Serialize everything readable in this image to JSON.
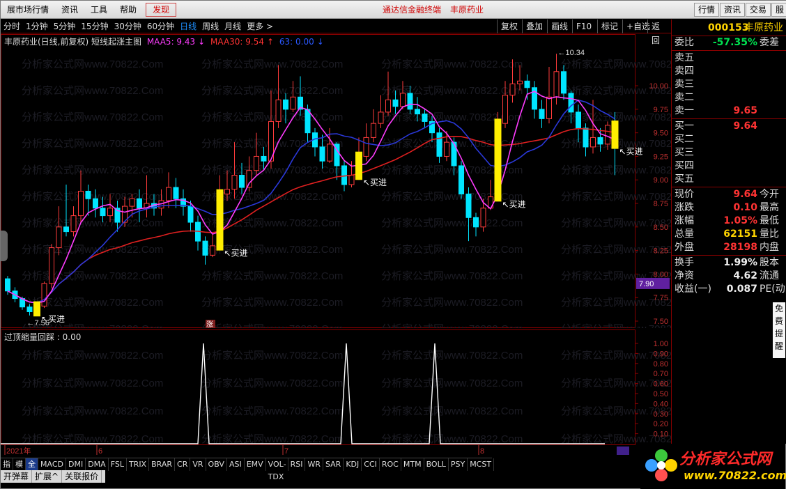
{
  "menubar": {
    "items": [
      "展市场行情",
      "资讯",
      "工具",
      "帮助",
      "发现"
    ],
    "center_title": "通达信金融终端",
    "center_stock": "丰原药业",
    "right_buttons": [
      "行情",
      "资讯",
      "交易",
      "服"
    ]
  },
  "periodbar": {
    "items": [
      "分时",
      "1分钟",
      "5分钟",
      "15分钟",
      "30分钟",
      "60分钟",
      "日线",
      "周线",
      "月线",
      "更多 >"
    ],
    "selected": "日线",
    "tools": [
      "复权",
      "叠加",
      "画线",
      "F10",
      "标记",
      "+自选",
      "返回"
    ]
  },
  "legend": {
    "title": "丰原药业(日线,前复权) 短线起涨主图",
    "maa5": "MAA5: 9.43",
    "maa30": "MAA30: 9.54",
    "extra": "63: 0.00"
  },
  "subchart": {
    "title": "过顶缩量回踩 : 0.00"
  },
  "chart_data": {
    "type": "candlestick",
    "ylim": [
      7.5,
      10.4
    ],
    "y_ticks": [
      "10.00",
      "9.75",
      "9.50",
      "9.25",
      "9.00",
      "8.75",
      "8.50",
      "8.25",
      "8.00",
      "7.75",
      "7.50"
    ],
    "y_tick_values": [
      10.0,
      9.75,
      9.5,
      9.25,
      9.0,
      8.75,
      8.5,
      8.25,
      8.0,
      7.75,
      7.5
    ],
    "current_price_tag": "7.90",
    "high_annotation": "10.34",
    "low_annotation": "7.56",
    "signal_label": "买进",
    "up_label": "涨",
    "x_labels": [
      "2021年",
      "6",
      "7",
      "8"
    ],
    "candles": [
      [
        7.95,
        7.82,
        7.98,
        7.78
      ],
      [
        7.82,
        7.74,
        7.86,
        7.7
      ],
      [
        7.74,
        7.65,
        7.76,
        7.62
      ],
      [
        7.65,
        7.6,
        7.68,
        7.56
      ],
      [
        7.6,
        7.66,
        7.7,
        7.58
      ],
      [
        7.66,
        7.9,
        7.92,
        7.64
      ],
      [
        7.9,
        8.28,
        8.32,
        7.85
      ],
      [
        8.28,
        8.5,
        8.72,
        8.2
      ],
      [
        8.5,
        8.45,
        8.95,
        8.4
      ],
      [
        8.45,
        8.62,
        8.72,
        8.4
      ],
      [
        8.62,
        8.88,
        9.1,
        8.55
      ],
      [
        8.88,
        8.8,
        8.95,
        8.62
      ],
      [
        8.8,
        8.7,
        8.9,
        8.6
      ],
      [
        8.7,
        8.62,
        8.82,
        8.55
      ],
      [
        8.62,
        8.7,
        8.85,
        8.55
      ],
      [
        8.7,
        8.55,
        8.78,
        8.45
      ],
      [
        8.55,
        8.72,
        8.82,
        8.5
      ],
      [
        8.72,
        8.8,
        8.85,
        8.6
      ],
      [
        8.8,
        8.7,
        8.9,
        8.55
      ],
      [
        8.7,
        8.75,
        9.05,
        8.6
      ],
      [
        8.75,
        8.7,
        8.85,
        8.62
      ],
      [
        8.7,
        8.78,
        8.9,
        8.62
      ],
      [
        8.78,
        8.92,
        9.08,
        8.7
      ],
      [
        8.92,
        8.8,
        9.02,
        8.7
      ],
      [
        8.8,
        8.72,
        8.9,
        8.62
      ],
      [
        8.72,
        8.55,
        8.78,
        8.45
      ],
      [
        8.55,
        8.35,
        8.62,
        8.25
      ],
      [
        8.35,
        8.2,
        8.4,
        8.1
      ],
      [
        8.2,
        8.3,
        8.42,
        8.18
      ],
      [
        8.3,
        8.85,
        9.05,
        8.3
      ],
      [
        8.85,
        8.9,
        9.1,
        8.78
      ],
      [
        8.9,
        9.05,
        9.4,
        8.8
      ],
      [
        9.05,
        8.92,
        9.18,
        8.85
      ],
      [
        8.92,
        9.1,
        9.25,
        8.88
      ],
      [
        9.1,
        9.25,
        9.5,
        9.05
      ],
      [
        9.25,
        9.2,
        9.35,
        9.1
      ],
      [
        9.2,
        9.62,
        9.95,
        9.12
      ],
      [
        9.62,
        9.85,
        10.22,
        9.55
      ],
      [
        9.85,
        9.75,
        9.92,
        9.6
      ],
      [
        9.75,
        9.88,
        10.05,
        9.72
      ],
      [
        9.88,
        9.75,
        10.1,
        9.68
      ],
      [
        9.75,
        9.5,
        9.8,
        9.4
      ],
      [
        9.5,
        9.35,
        9.55,
        9.25
      ],
      [
        9.35,
        9.2,
        9.48,
        9.12
      ],
      [
        9.2,
        9.38,
        9.55,
        9.18
      ],
      [
        9.38,
        9.15,
        9.4,
        9.0
      ],
      [
        9.15,
        8.95,
        9.2,
        8.88
      ],
      [
        8.95,
        9.05,
        9.2,
        8.92
      ],
      [
        9.05,
        9.25,
        9.45,
        9.0
      ],
      [
        9.25,
        9.45,
        9.6,
        9.2
      ],
      [
        9.45,
        9.6,
        9.75,
        9.4
      ],
      [
        9.6,
        9.72,
        9.9,
        9.55
      ],
      [
        9.72,
        9.85,
        10.15,
        9.68
      ],
      [
        9.85,
        9.78,
        9.95,
        9.7
      ],
      [
        9.78,
        9.92,
        10.05,
        9.75
      ],
      [
        9.92,
        9.75,
        10.0,
        9.7
      ],
      [
        9.75,
        9.7,
        9.88,
        9.62
      ],
      [
        9.7,
        9.62,
        9.75,
        9.55
      ],
      [
        9.62,
        9.5,
        9.68,
        9.4
      ],
      [
        9.5,
        9.25,
        9.55,
        9.18
      ],
      [
        9.25,
        9.4,
        9.52,
        9.2
      ],
      [
        9.4,
        9.15,
        9.45,
        9.05
      ],
      [
        9.15,
        8.85,
        9.2,
        8.8
      ],
      [
        8.85,
        8.6,
        8.92,
        8.35
      ],
      [
        8.6,
        8.5,
        8.65,
        8.4
      ],
      [
        8.5,
        8.7,
        8.8,
        8.45
      ],
      [
        8.7,
        8.82,
        9.0,
        8.68
      ],
      [
        8.82,
        9.6,
        9.72,
        8.8
      ],
      [
        9.6,
        9.9,
        10.05,
        9.55
      ],
      [
        9.9,
        10.02,
        10.28,
        9.82
      ],
      [
        10.02,
        10.05,
        10.22,
        9.95
      ],
      [
        10.05,
        9.98,
        10.12,
        9.85
      ],
      [
        9.98,
        9.75,
        10.05,
        9.65
      ],
      [
        9.75,
        9.65,
        9.85,
        9.55
      ],
      [
        9.65,
        9.88,
        10.2,
        9.6
      ],
      [
        9.88,
        10.15,
        10.34,
        9.8
      ],
      [
        10.15,
        9.92,
        10.22,
        9.85
      ],
      [
        9.92,
        9.72,
        9.95,
        9.6
      ],
      [
        9.72,
        9.55,
        9.8,
        9.4
      ],
      [
        9.55,
        9.35,
        9.6,
        9.25
      ],
      [
        9.35,
        9.45,
        9.85,
        9.28
      ],
      [
        9.45,
        9.38,
        9.55,
        9.3
      ],
      [
        9.38,
        9.58,
        9.62,
        9.32
      ],
      [
        9.58,
        9.38,
        9.72,
        9.05
      ]
    ],
    "buy_signals": [
      4,
      29,
      48,
      67,
      83
    ],
    "indicator_x": [
      0,
      283,
      291,
      299,
      488,
      496,
      504,
      615,
      623,
      631,
      867
    ],
    "indicator_ylim": [
      0,
      1.0
    ],
    "indicator_ticks": [
      "1.00",
      "0.90",
      "0.80",
      "0.70",
      "0.60",
      "0.50",
      "0.40",
      "0.30",
      "0.20",
      "0.10"
    ]
  },
  "rpanel": {
    "code": "000153",
    "name": "丰原药业",
    "weibi": {
      "label": "委比",
      "value": "-57.35%",
      "label2": "委差"
    },
    "sells": [
      {
        "label": "卖五",
        "price": ""
      },
      {
        "label": "卖四",
        "price": ""
      },
      {
        "label": "卖三",
        "price": ""
      },
      {
        "label": "卖二",
        "price": ""
      },
      {
        "label": "卖一",
        "price": "9.65"
      }
    ],
    "buys": [
      {
        "label": "买一",
        "price": "9.64"
      },
      {
        "label": "买二",
        "price": ""
      },
      {
        "label": "买三",
        "price": ""
      },
      {
        "label": "买四",
        "price": ""
      },
      {
        "label": "买五",
        "price": ""
      }
    ],
    "stats": [
      {
        "label": "现价",
        "value": "9.64",
        "label2": "今开",
        "color": "#ff3333"
      },
      {
        "label": "涨跌",
        "value": "0.10",
        "label2": "最高",
        "color": "#ff3333"
      },
      {
        "label": "涨幅",
        "value": "1.05%",
        "label2": "最低",
        "color": "#ff3333"
      },
      {
        "label": "总量",
        "value": "62151",
        "label2": "量比",
        "color": "#ffd400"
      },
      {
        "label": "外盘",
        "value": "28198",
        "label2": "内盘",
        "color": "#ff3333"
      }
    ],
    "stats2": [
      {
        "label": "换手",
        "value": "1.99%",
        "label2": "股本",
        "color": "#eeeeee"
      },
      {
        "label": "净资",
        "value": "4.62",
        "label2": "流通",
        "color": "#eeeeee"
      },
      {
        "label": "收益(一)",
        "value": "0.087",
        "label2": "PE(动)",
        "color": "#eeeeee"
      }
    ]
  },
  "bottombar": {
    "tabs": [
      "指标",
      "模板",
      "全部",
      "MACD",
      "DMI",
      "DMA",
      "FSL",
      "TRIX",
      "BRAR",
      "CR",
      "VR",
      "OBV",
      "ASI",
      "EMV",
      "VOL-TDX",
      "RSI",
      "WR",
      "SAR",
      "KDJ",
      "CCI",
      "ROC",
      "MTM",
      "BOLL",
      "PSY",
      "MCST"
    ],
    "selected": "全部",
    "tabs2": [
      "开弹幕",
      "扩展^",
      "关联报价"
    ]
  },
  "rsidebar": [
    "免",
    "费",
    "提",
    "醒"
  ],
  "watermark": "分析家公式网www.70822.Com",
  "logo": {
    "line1": "分析家公式网",
    "line2": "www.70822.com"
  },
  "colors": {
    "up": "#ff3b3b",
    "down": "#00e5ff",
    "signal": "#ffee00",
    "maa5": "#ff3cff",
    "maa30": "#e02020",
    "ma_blue": "#2a38d8"
  }
}
